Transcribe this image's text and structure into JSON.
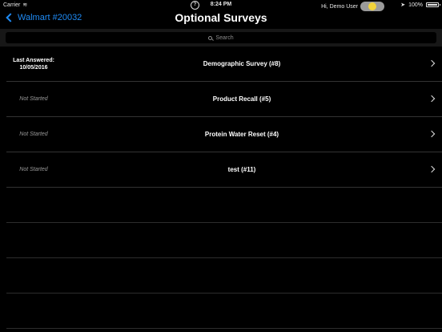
{
  "statusbar": {
    "carrier": "Carrier",
    "time": "8:24 PM",
    "battery": "100%"
  },
  "navbar": {
    "back_label": "Walmart #20032",
    "title": "Optional Surveys",
    "user_label": "Hi, Demo User"
  },
  "search": {
    "placeholder": "Search"
  },
  "surveys": [
    {
      "status_line1": "Last Answered:",
      "status_line2": "10/05/2016",
      "name": "Demographic Survey (#8)"
    },
    {
      "status_line1": "Not Started",
      "status_line2": "",
      "name": "Product Recall (#5)"
    },
    {
      "status_line1": "Not Started",
      "status_line2": "",
      "name": "Protein Water Reset (#4)"
    },
    {
      "status_line1": "Not Started",
      "status_line2": "",
      "name": "test (#11)"
    }
  ],
  "colors": {
    "accent": "#1f8bf5",
    "background": "#000000",
    "toggle_knob": "#f1d33b"
  }
}
